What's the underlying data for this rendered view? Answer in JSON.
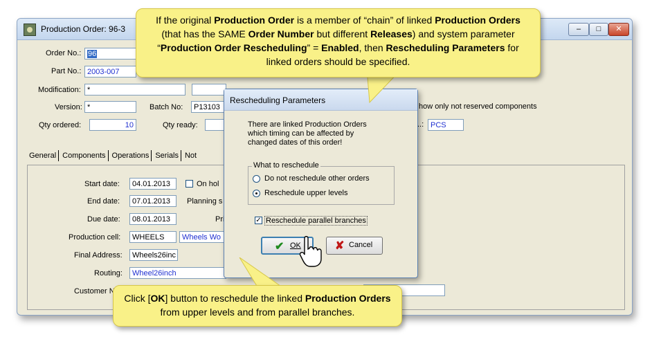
{
  "window": {
    "title": "Production Order: 96-3",
    "minimize": "–",
    "maximize": "□",
    "close": "✕"
  },
  "form": {
    "order_no_label": "Order No.:",
    "order_no": "96",
    "part_no_label": "Part No.:",
    "part_no": "2003-007",
    "modification_label": "Modification:",
    "modification": "*",
    "version_label": "Version:",
    "version": "*",
    "batch_no_label": "Batch No:",
    "batch_no": "P13103",
    "qty_ordered_label": "Qty ordered:",
    "qty_ordered": "10",
    "qty_ready_label": "Qty ready:",
    "show_reserved_label": "how only not reserved components",
    "unit_label": "..:",
    "unit": "PCS"
  },
  "tabs": [
    "General",
    "Components",
    "Operations",
    "Serials",
    "Not"
  ],
  "general": {
    "start_date_label": "Start date:",
    "start_date": "04.01.2013",
    "on_hold_label": "On hol",
    "end_date_label": "End date:",
    "end_date": "07.01.2013",
    "planning_label": "Planning s",
    "due_date_label": "Due date:",
    "due_date": "08.01.2013",
    "pri_label": "Pri",
    "production_cell_label": "Production cell:",
    "production_cell": "WHEELS",
    "production_cell_name": "Wheels Wo",
    "final_address_label": "Final Address:",
    "final_address": "Wheels26inc",
    "routing_label": "Routing:",
    "routing": "Wheel26inch",
    "customer_label": "Customer N"
  },
  "dialog": {
    "title": "Rescheduling Parameters",
    "message_1": "There are linked Production Orders",
    "message_2": "which timing can be affected by",
    "message_3": "changed dates of this order!",
    "group_label": "What to reschedule",
    "radio_1": "Do not reschedule other orders",
    "radio_2": "Reschedule upper levels",
    "checkbox": "Reschedule parallel branches",
    "ok": "OK",
    "cancel": "Cancel"
  },
  "callout_top": {
    "p1": "If the original ",
    "b1": "Production Order",
    "p2": " is a member of “chain” of linked ",
    "b2": "Production Orders",
    "p3": " (that has the SAME ",
    "b3": "Order Number",
    "p4": " but different ",
    "b4": "Releases",
    "p5": ") and system parameter “",
    "b5": "Production  Order Rescheduling",
    "p6": "” = ",
    "b6": "Enabled",
    "p7": ", then ",
    "b7": "Rescheduling Parameters",
    "p8": " for linked orders should be specified."
  },
  "callout_bottom": {
    "p1": "Click [",
    "b1": "OK",
    "p2": "] button to reschedule the linked ",
    "b2": "Production Orders",
    "p3": " from upper levels and from parallel branches."
  },
  "colors": {
    "callout_bg": "#f9f188",
    "field_blue_text": "#1f2fd0",
    "selection": "#316ac5"
  }
}
